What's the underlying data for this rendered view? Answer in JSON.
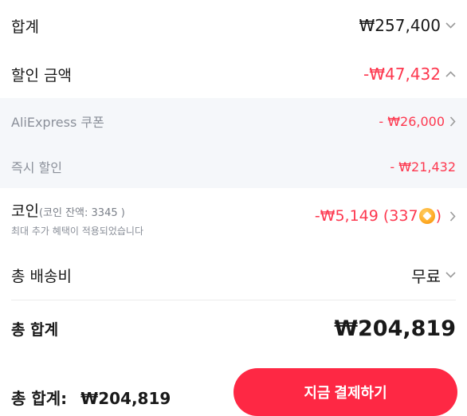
{
  "subtotal": {
    "label": "합계",
    "value": "₩257,400"
  },
  "discount": {
    "label": "할인 금액",
    "value": "-₩47,432"
  },
  "coupon": {
    "label": "AliExpress 쿠폰",
    "value": "- ₩26,000"
  },
  "instant": {
    "label": "즉시 할인",
    "value": "- ₩21,432"
  },
  "coins": {
    "label": "코인",
    "balance_note": "(코인 잔액: 3345 )",
    "subtext": "최대 추가 혜택이 적용되었습니다",
    "value": "-₩5,149 (337",
    "value_suffix": ")"
  },
  "shipping": {
    "label": "총 배송비",
    "value": "무료"
  },
  "grand_total": {
    "label": "총 합계",
    "value": "₩204,819"
  },
  "footer": {
    "total_label": "총 합계:",
    "total_value": "₩204,819",
    "pay_label": "지금 결제하기"
  },
  "colors": {
    "accent": "#fd384f",
    "button": "#fe2844",
    "panel": "#f5f7fa"
  },
  "icons": [
    "chevron-down-icon",
    "chevron-up-icon",
    "chevron-right-icon",
    "coin-icon"
  ]
}
